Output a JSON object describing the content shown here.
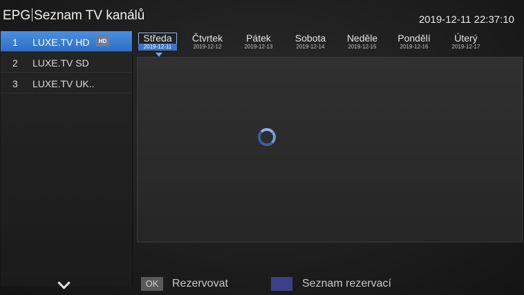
{
  "header": {
    "app_label": "EPG",
    "title": "Seznam TV kanálů",
    "clock": "2019-12-11 22:37:10"
  },
  "channels": [
    {
      "number": "1",
      "name": "LUXE.TV HD",
      "badge": "HD",
      "selected": true
    },
    {
      "number": "2",
      "name": "LUXE.TV SD"
    },
    {
      "number": "3",
      "name": "LUXE.TV UK.."
    }
  ],
  "days": [
    {
      "name": "Středa",
      "date": "2019-12-11",
      "selected": true
    },
    {
      "name": "Čtvrtek",
      "date": "2019-12-12"
    },
    {
      "name": "Pátek",
      "date": "2019-12-13"
    },
    {
      "name": "Sobota",
      "date": "2019-12-14"
    },
    {
      "name": "Neděle",
      "date": "2019-12-15"
    },
    {
      "name": "Pondělí",
      "date": "2019-12-16"
    },
    {
      "name": "Úterý",
      "date": "2019-12-17"
    }
  ],
  "footer": {
    "ok_key": "OK",
    "ok_label": "Rezervovat",
    "blue_key_color": "#3b3f8c",
    "blue_label": "Seznam rezervací"
  },
  "accent_color": "#3e7fd6"
}
